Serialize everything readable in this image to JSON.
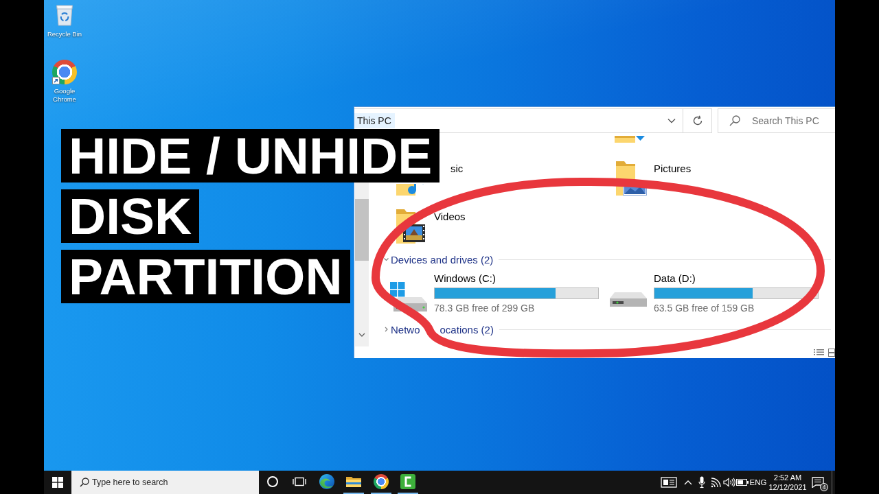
{
  "desktop": {
    "icons": [
      {
        "kind": "recycle-bin",
        "label": "Recycle Bin",
        "shortcut": false
      },
      {
        "kind": "chrome",
        "label": "Google Chrome",
        "shortcut": true
      }
    ]
  },
  "title_overlay": {
    "lines": [
      "HIDE / UNHIDE",
      "DISK",
      "PARTITION"
    ]
  },
  "explorer": {
    "address": {
      "breadcrumb": "This PC",
      "hovered": true
    },
    "search": {
      "placeholder": "Search This PC"
    },
    "folders": [
      {
        "kind": "music",
        "label": "sic"
      },
      {
        "kind": "pictures",
        "label": "Pictures"
      },
      {
        "kind": "videos",
        "label": "Videos"
      }
    ],
    "groups": [
      {
        "title_parts": [
          "Devices and drives (2)"
        ],
        "expanded": true,
        "drives": [
          {
            "kind": "system",
            "name": "Windows (C:)",
            "level": 0.74,
            "free_space": "78.3 GB free of 299 GB"
          },
          {
            "kind": "data",
            "name": "Data (D:)",
            "level": 0.6,
            "free_space": "63.5 GB free of 159 GB"
          }
        ]
      },
      {
        "title_parts": [
          "Netwo",
          "ocations (2)"
        ],
        "expanded": false
      }
    ]
  },
  "taskbar": {
    "search": {
      "placeholder": "Type here to search"
    },
    "apps": [
      {
        "kind": "cortana",
        "running": false
      },
      {
        "kind": "task-view",
        "running": false
      },
      {
        "kind": "edge",
        "running": false
      },
      {
        "kind": "file-explorer",
        "running": true
      },
      {
        "kind": "chrome",
        "running": true
      },
      {
        "kind": "camtasia",
        "running": true
      }
    ],
    "tray": {
      "language": "ENG",
      "time": "2:52 AM",
      "date": "12/12/2021",
      "notification_count": "4"
    }
  }
}
